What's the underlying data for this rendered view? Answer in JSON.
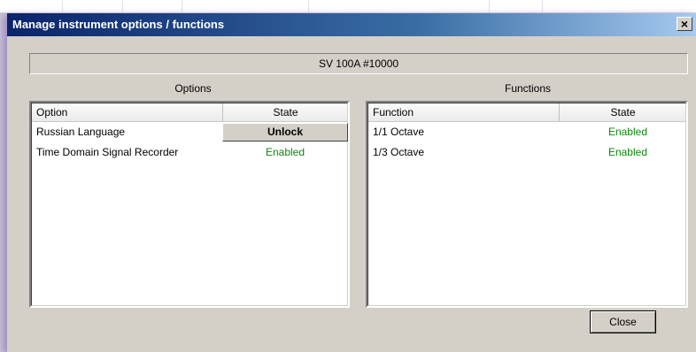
{
  "window": {
    "title": "Manage instrument options / functions",
    "close_glyph": "×"
  },
  "device": {
    "label": "SV 100A #10000"
  },
  "options": {
    "group_title": "Options",
    "columns": [
      "Option",
      "State"
    ],
    "rows": [
      {
        "name": "Russian Language",
        "state": "Unlock",
        "state_type": "button"
      },
      {
        "name": "Time Domain Signal Recorder",
        "state": "Enabled",
        "state_type": "text"
      }
    ]
  },
  "functions": {
    "group_title": "Functions",
    "columns": [
      "Function",
      "State"
    ],
    "rows": [
      {
        "name": "1/1 Octave",
        "state": "Enabled"
      },
      {
        "name": "1/3 Octave",
        "state": "Enabled"
      }
    ]
  },
  "footer": {
    "close_label": "Close"
  },
  "colors": {
    "enabled_text": "#0b8a0b",
    "titlebar_start": "#0a246a",
    "titlebar_end": "#a6caf0",
    "dialog_face": "#d4d0c8"
  }
}
